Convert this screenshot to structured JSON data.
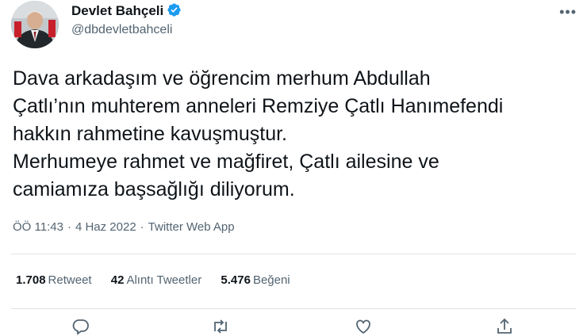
{
  "author": {
    "display_name": "Devlet Bahçeli",
    "handle": "@dbdevletbahceli",
    "avatar_icon": "profile-photo",
    "verified_icon": "verified-badge-icon"
  },
  "header": {
    "more_icon": "more-horizontal-icon",
    "more_glyph": "•••"
  },
  "tweet": {
    "text_lines": [
      "Dava arkadaşım ve öğrencim merhum Abdullah",
      "Çatlı’nın muhterem anneleri Remziye Çatlı Hanımefendi",
      "hakkın rahmetine kavuşmuştur.",
      "Merhumeye rahmet ve mağfiret, Çatlı ailesine ve",
      "camiamıza başsağlığı diliyorum."
    ],
    "time": "ÖÖ 11:43",
    "separator": "·",
    "date": "4 Haz 2022",
    "source": "Twitter Web App"
  },
  "stats": {
    "retweets": {
      "count": "1.708",
      "label": "Retweet"
    },
    "quotes": {
      "count": "42",
      "label": "Alıntı Tweetler"
    },
    "likes": {
      "count": "5.476",
      "label": "Beğeni"
    }
  },
  "actions": [
    "reply-icon",
    "retweet-icon",
    "like-icon",
    "share-icon"
  ],
  "colors": {
    "text": "#0f1419",
    "secondary": "#536471",
    "verified": "#1d9bf0",
    "divider": "#dfe3e7"
  }
}
